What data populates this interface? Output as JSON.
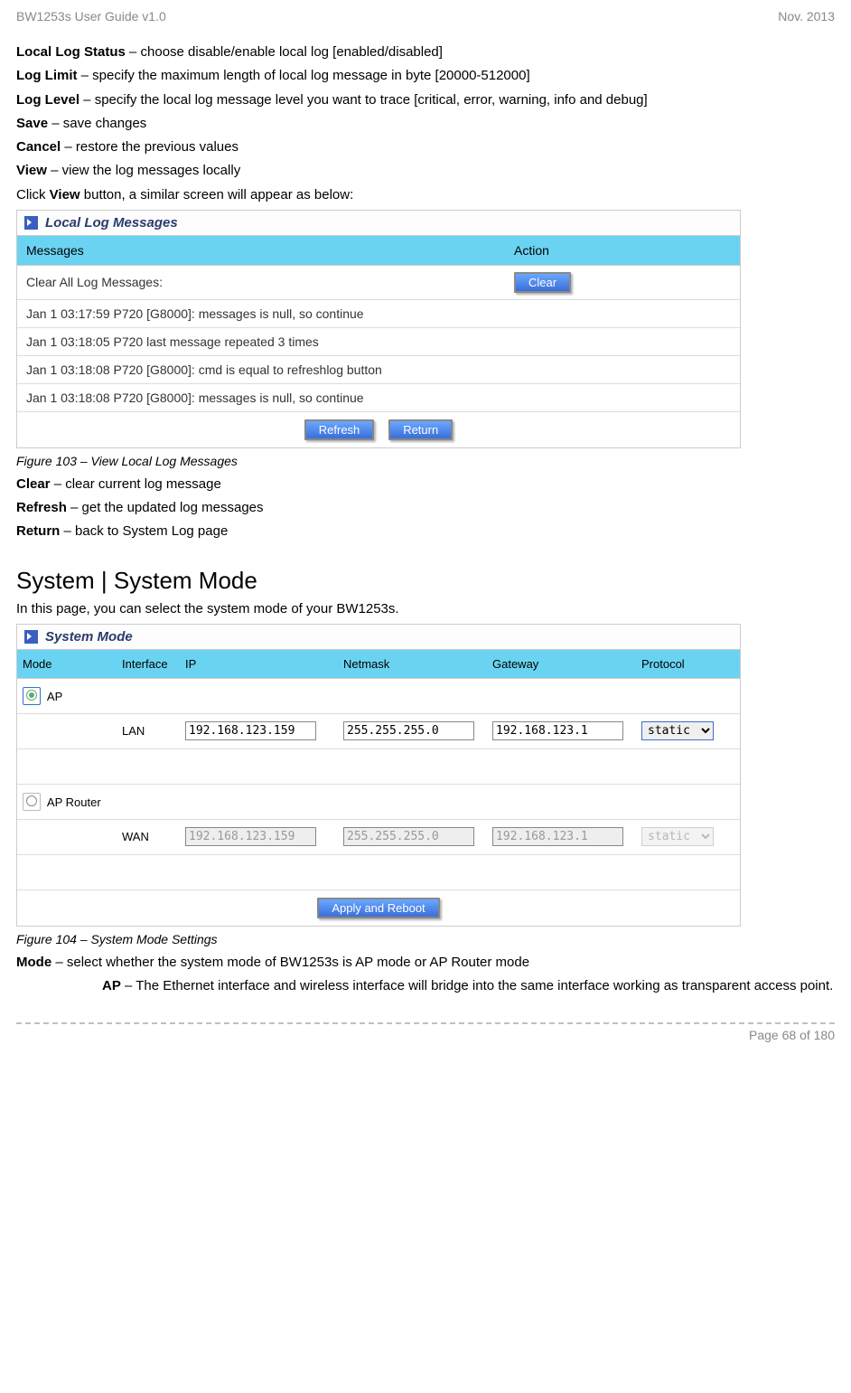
{
  "header": {
    "left": "BW1253s User Guide v1.0",
    "right": "Nov.  2013"
  },
  "defs": [
    {
      "term": "Local Log Status",
      "desc": " – choose disable/enable local log [enabled/disabled]"
    },
    {
      "term": "Log Limit",
      "desc": " – specify the maximum length of local log message in byte [20000-512000]"
    },
    {
      "term": "Log Level",
      "desc": " – specify the local log message level you want to trace [critical, error, warning, info and debug]"
    },
    {
      "term": "Save",
      "desc": " – save changes"
    },
    {
      "term": "Cancel",
      "desc": " – restore the previous values"
    },
    {
      "term": "View",
      "desc": " – view the log messages locally"
    }
  ],
  "click_view_prefix": "Click ",
  "click_view_bold": "View",
  "click_view_suffix": " button, a similar screen will appear as below:",
  "panel1": {
    "title": "Local Log Messages",
    "col_messages": "Messages",
    "col_action": "Action",
    "clear_row": "Clear All Log Messages:",
    "clear_btn": "Clear",
    "rows": [
      "Jan 1 03:17:59 P720 [G8000]: messages is null, so continue",
      "Jan 1 03:18:05 P720 last message repeated 3 times",
      "Jan 1 03:18:08 P720 [G8000]: cmd is equal to refreshlog button",
      "Jan 1 03:18:08 P720 [G8000]: messages is null, so continue"
    ],
    "refresh_btn": "Refresh",
    "return_btn": "Return"
  },
  "caption1": "Figure 103 – View Local Log Messages",
  "defs2": [
    {
      "term": "Clear",
      "desc": " – clear current log message"
    },
    {
      "term": "Refresh",
      "desc": " – get the updated log messages"
    },
    {
      "term": "Return",
      "desc": " – back to System Log page"
    }
  ],
  "section2_title": "System | System Mode",
  "section2_intro": "In this page, you can select the system mode of your BW1253s.",
  "panel2": {
    "title": "System Mode",
    "cols": {
      "mode": "Mode",
      "if": "Interface",
      "ip": "IP",
      "nm": "Netmask",
      "gw": "Gateway",
      "pr": "Protocol"
    },
    "ap_label": "AP",
    "lan_label": "LAN",
    "ap_ip": "192.168.123.159",
    "ap_nm": "255.255.255.0",
    "ap_gw": "192.168.123.1",
    "ap_proto": "static",
    "apr_label": "AP Router",
    "wan_label": "WAN",
    "wan_ip": "192.168.123.159",
    "wan_nm": "255.255.255.0",
    "wan_gw": "192.168.123.1",
    "wan_proto": "static",
    "apply_btn": "Apply and Reboot"
  },
  "caption2": "Figure 104 – System Mode Settings",
  "mode_term": "Mode",
  "mode_desc": " – select whether the system mode of BW1253s is AP mode or AP Router mode",
  "ap_term": "AP",
  "ap_desc": " – The Ethernet interface and wireless interface will bridge into the same interface working as transparent access point.",
  "footer": "Page 68 of 180"
}
